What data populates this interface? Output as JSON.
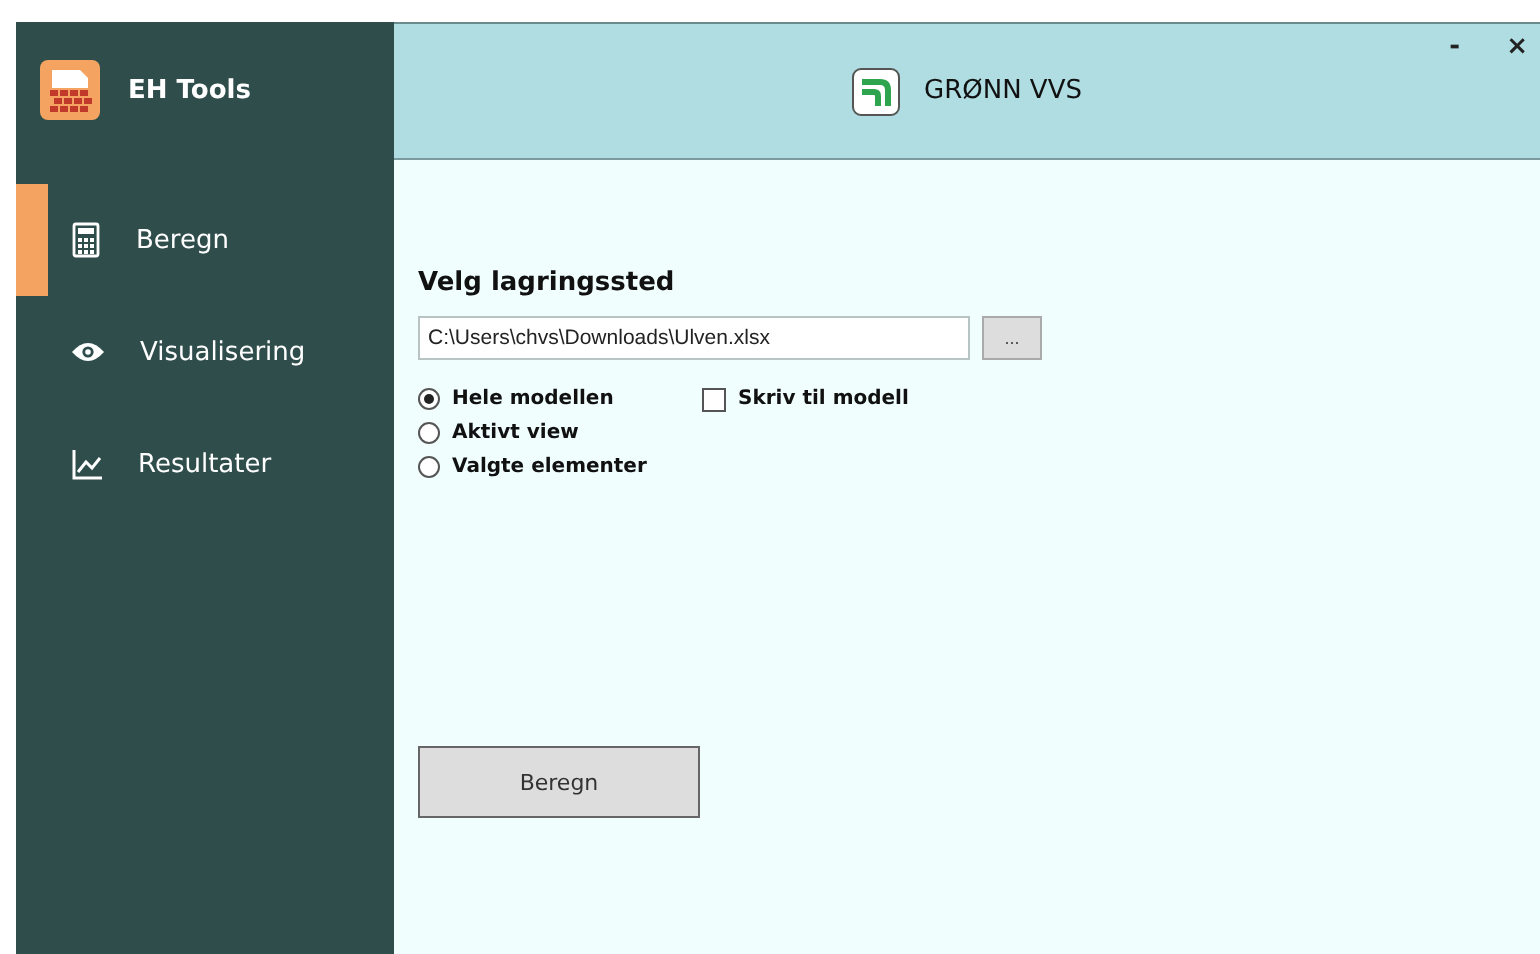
{
  "app": {
    "title": "EH Tools"
  },
  "nav": [
    {
      "label": "Beregn",
      "kind": "calculator",
      "selected": true
    },
    {
      "label": "Visualisering",
      "kind": "eye",
      "selected": false
    },
    {
      "label": "Resultater",
      "kind": "chart",
      "selected": false
    }
  ],
  "header": {
    "title": "GRØNN VVS",
    "minimize": "-",
    "close": "×"
  },
  "section_title": "Velg lagringssted",
  "path_field": {
    "value": "C:\\Users\\chvs\\Downloads\\Ulven.xlsx"
  },
  "browse_button": "...",
  "scope_options": [
    {
      "label": "Hele modellen",
      "selected": true
    },
    {
      "label": "Aktivt view",
      "selected": false
    },
    {
      "label": "Valgte elementer",
      "selected": false
    }
  ],
  "write_checkbox": {
    "label": "Skriv til modell",
    "checked": false
  },
  "run_button": "Beregn"
}
